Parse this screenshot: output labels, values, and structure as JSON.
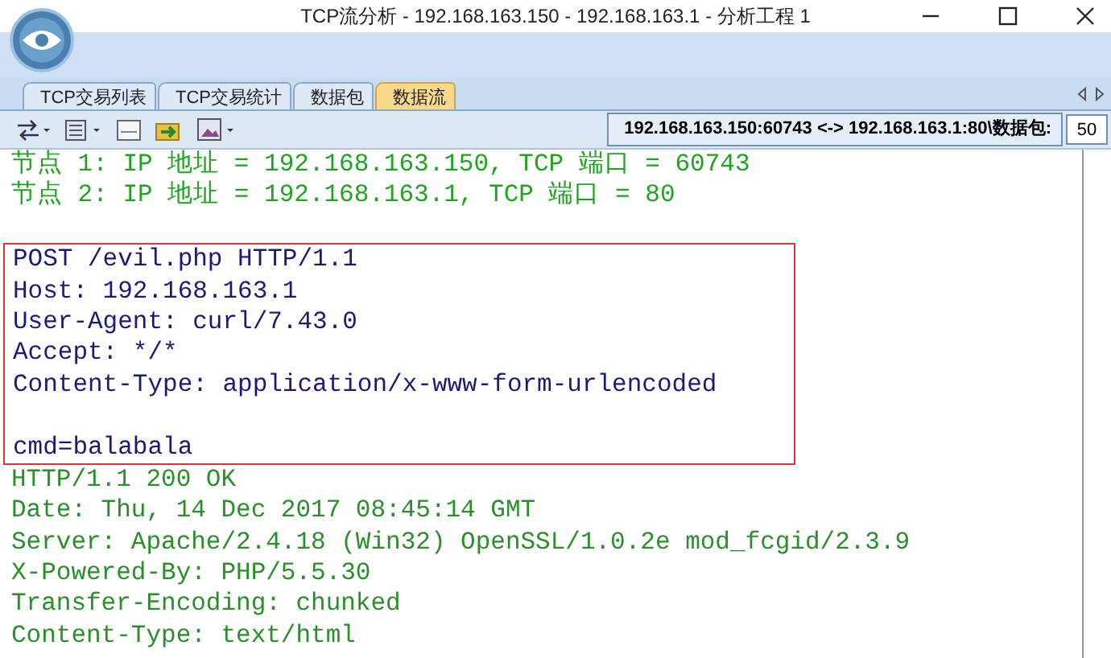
{
  "window": {
    "title": "TCP流分析 - 192.168.163.150 - 192.168.163.1 - 分析工程 1"
  },
  "tabs": [
    {
      "label": "TCP交易列表",
      "selected": false
    },
    {
      "label": "TCP交易统计",
      "selected": false
    },
    {
      "label": "数据包",
      "selected": false
    },
    {
      "label": "数据流",
      "selected": true
    }
  ],
  "toolbar": {
    "connection": "192.168.163.150:60743 <-> 192.168.163.1:80\\数据包:",
    "packet_count": "50"
  },
  "nodes": [
    "节点 1: IP 地址 = 192.168.163.150, TCP 端口 = 60743",
    "节点 2: IP 地址 = 192.168.163.1, TCP 端口 = 80"
  ],
  "request": {
    "highlighted": true,
    "headers": [
      "POST /evil.php HTTP/1.1",
      "Host: 192.168.163.1",
      "User-Agent: curl/7.43.0",
      "Accept: */*",
      "Content-Type: application/x-www-form-urlencoded"
    ],
    "body": "cmd=balabala"
  },
  "response": [
    "HTTP/1.1 200 OK",
    "Date: Thu, 14 Dec 2017 08:45:14 GMT",
    "Server: Apache/2.4.18 (Win32) OpenSSL/1.0.2e mod_fcgid/2.3.9",
    "X-Powered-By: PHP/5.5.30",
    "Transfer-Encoding: chunked",
    "Content-Type: text/html"
  ]
}
